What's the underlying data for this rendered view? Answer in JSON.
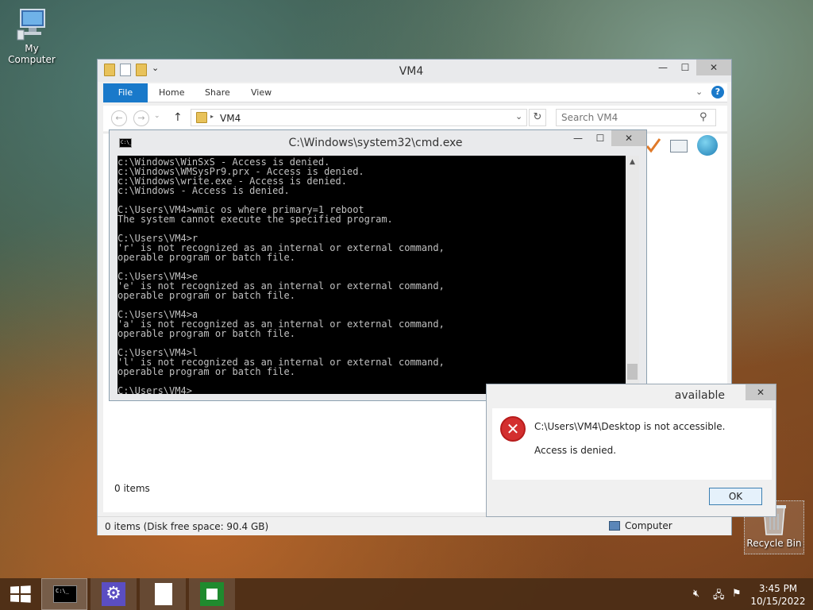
{
  "desktop": {
    "my_computer": "My Computer",
    "recycle_bin": "Recycle Bin"
  },
  "explorer": {
    "title": "VM4",
    "tabs": [
      "File",
      "Home",
      "Share",
      "View"
    ],
    "address": "VM4",
    "search_placeholder": "Search VM4",
    "items_count": "0 items",
    "status": "0 items (Disk free space: 90.4 GB)",
    "status_location": "Computer"
  },
  "cmd": {
    "title": "C:\\Windows\\system32\\cmd.exe",
    "icon_text": "C:\\_",
    "output": "c:\\Windows\\WinSxS - Access is denied.\nc:\\Windows\\WMSysPr9.prx - Access is denied.\nc:\\Windows\\write.exe - Access is denied.\nc:\\Windows - Access is denied.\n\nC:\\Users\\VM4>wmic os where primary=1 reboot\nThe system cannot execute the specified program.\n\nC:\\Users\\VM4>r\n'r' is not recognized as an internal or external command,\noperable program or batch file.\n\nC:\\Users\\VM4>e\n'e' is not recognized as an internal or external command,\noperable program or batch file.\n\nC:\\Users\\VM4>a\n'a' is not recognized as an internal or external command,\noperable program or batch file.\n\nC:\\Users\\VM4>l\n'l' is not recognized as an internal or external command,\noperable program or batch file.\n\nC:\\Users\\VM4>"
  },
  "dialog": {
    "title": "available",
    "message": "C:\\Users\\VM4\\Desktop is not accessible.",
    "detail": "Access is denied.",
    "ok_label": "OK"
  },
  "taskbar": {
    "cmd_icon_text": "C:\\_",
    "time": "3:45 PM",
    "date": "10/15/2022"
  },
  "icons": {
    "minimize": "—",
    "maximize": "☐",
    "close": "✕",
    "help": "?",
    "refresh": "↻",
    "search": "⚲",
    "back": "←",
    "forward": "→",
    "up": "↑",
    "chevron_down": "⌄",
    "scroll_up": "▲",
    "scroll_down": "▼",
    "settings_gear": "⚙",
    "error": "✕",
    "volume_muted": "🔇︎",
    "network": "🖧︎",
    "flag": "⚑"
  },
  "colors": {
    "accent": "#1979ca",
    "error": "#d32f2f",
    "console_bg": "#000000",
    "console_fg": "#c0c0c0"
  }
}
